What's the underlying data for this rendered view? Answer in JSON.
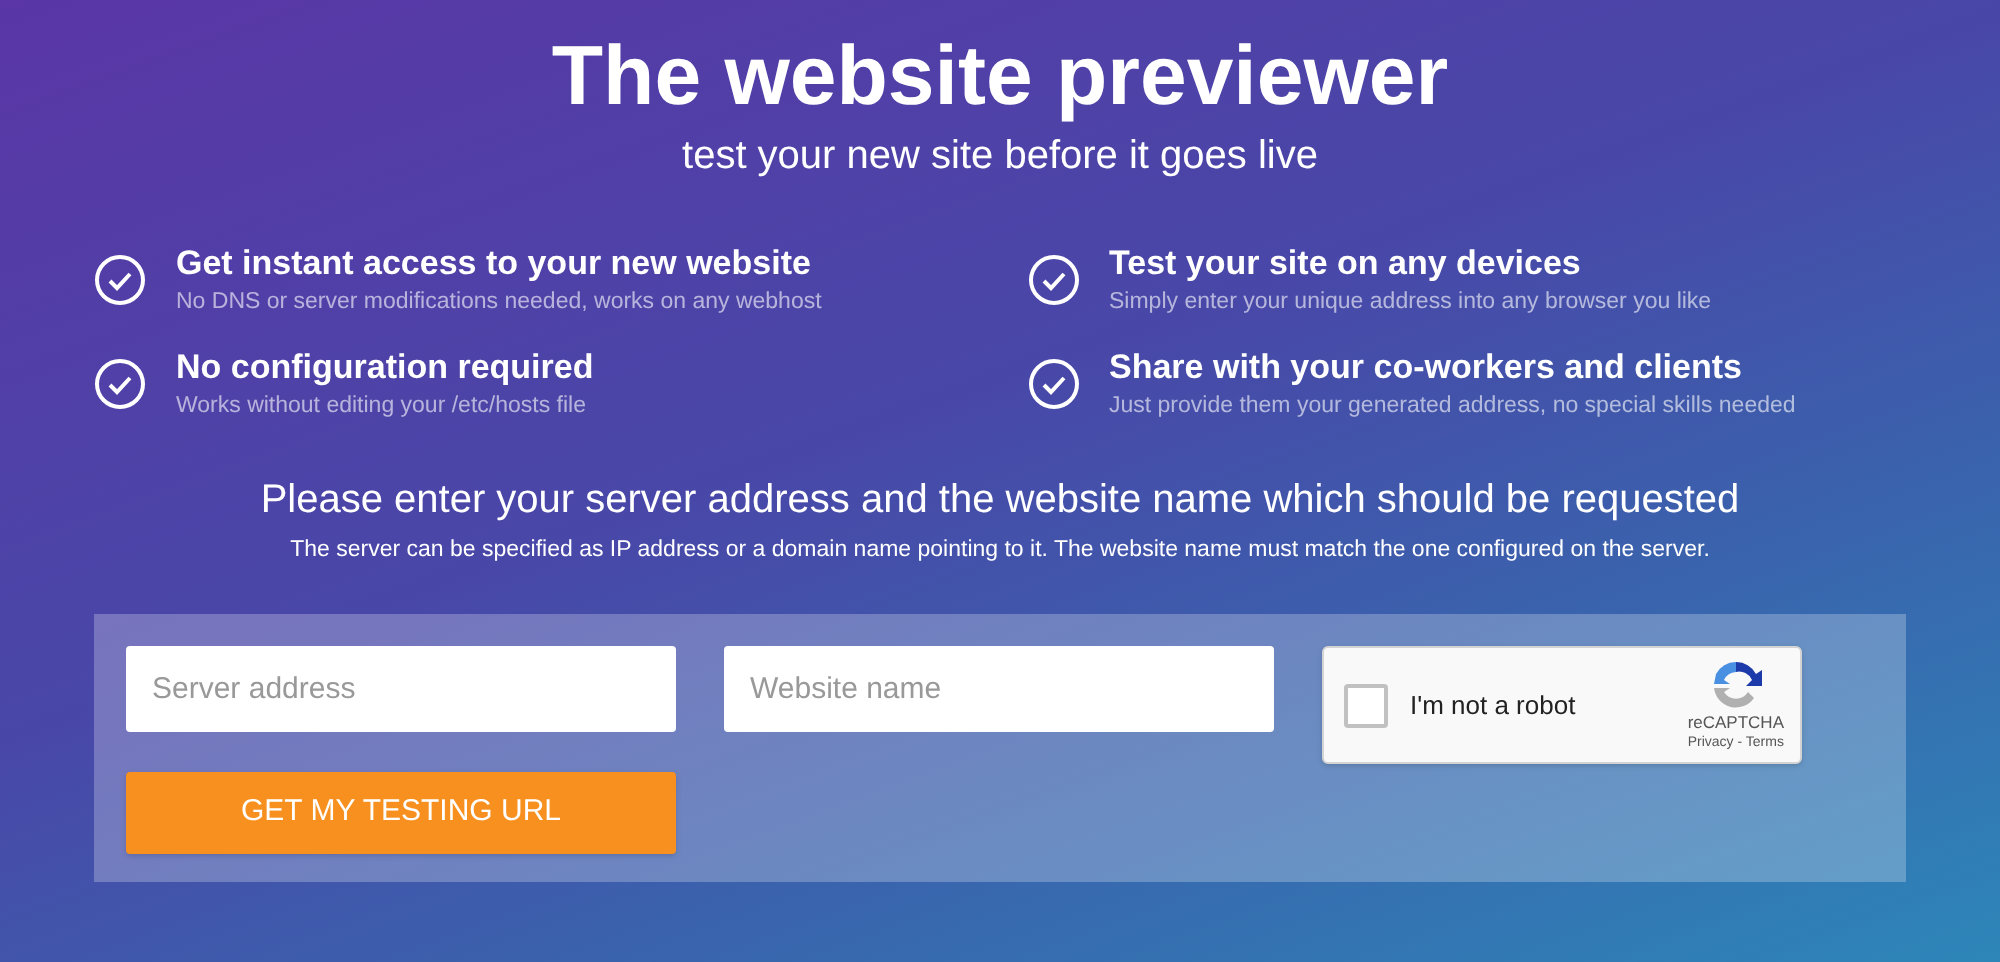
{
  "header": {
    "title": "The website previewer",
    "subtitle": "test your new site before it goes live"
  },
  "features": [
    {
      "title": "Get instant access to your new website",
      "description": "No DNS or server modifications needed, works on any webhost"
    },
    {
      "title": "Test your site on any devices",
      "description": "Simply enter your unique address into any browser you like"
    },
    {
      "title": "No configuration required",
      "description": "Works without editing your /etc/hosts file"
    },
    {
      "title": "Share with your co-workers and clients",
      "description": "Just provide them your generated address, no special skills needed"
    }
  ],
  "form": {
    "heading": "Please enter your server address and the website name which should be requested",
    "note": "The server can be specified as IP address or a domain name pointing to it. The website name must match the one configured on the server.",
    "fields": [
      {
        "placeholder": "Server address"
      },
      {
        "placeholder": "Website name"
      }
    ],
    "captcha": {
      "label": "I'm not a robot",
      "checked": false,
      "brand": "reCAPTCHA",
      "links": "Privacy - Terms"
    },
    "submit": "GET MY TESTING URL"
  }
}
